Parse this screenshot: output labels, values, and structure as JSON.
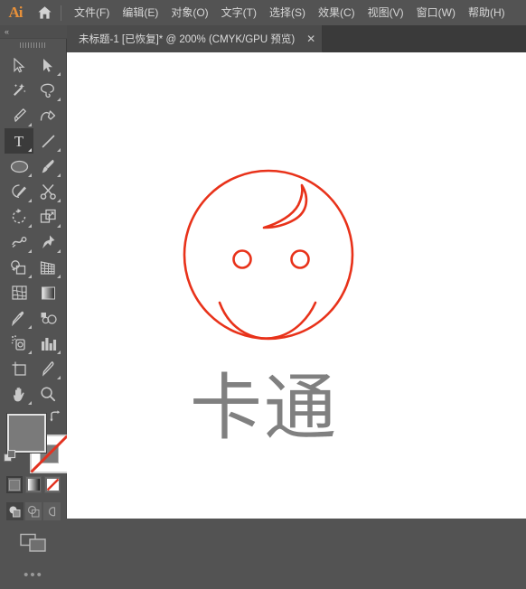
{
  "app": {
    "logo_text": "Ai",
    "home_icon": "home-icon"
  },
  "menubar": {
    "items": [
      {
        "label": "文件(F)",
        "name": "menu-file"
      },
      {
        "label": "编辑(E)",
        "name": "menu-edit"
      },
      {
        "label": "对象(O)",
        "name": "menu-object"
      },
      {
        "label": "文字(T)",
        "name": "menu-type"
      },
      {
        "label": "选择(S)",
        "name": "menu-select"
      },
      {
        "label": "效果(C)",
        "name": "menu-effect"
      },
      {
        "label": "视图(V)",
        "name": "menu-view"
      },
      {
        "label": "窗口(W)",
        "name": "menu-window"
      },
      {
        "label": "帮助(H)",
        "name": "menu-help"
      }
    ]
  },
  "tabbar": {
    "tab_title": "未标题-1 [已恢复]* @ 200% (CMYK/GPU 预览)",
    "close_label": "✕"
  },
  "toolbar": {
    "collapse_label": "«",
    "more_label": "•••",
    "tools": [
      {
        "name": "selection-tool",
        "icon": "arrow-outline-icon",
        "selected": false,
        "corner": false
      },
      {
        "name": "direct-selection-tool",
        "icon": "arrow-filled-icon",
        "selected": false,
        "corner": true
      },
      {
        "name": "magic-wand-tool",
        "icon": "magic-wand-icon",
        "selected": false,
        "corner": false
      },
      {
        "name": "lasso-tool",
        "icon": "lasso-icon",
        "selected": false,
        "corner": true
      },
      {
        "name": "pen-tool",
        "icon": "pen-icon",
        "selected": false,
        "corner": true
      },
      {
        "name": "curvature-tool",
        "icon": "curvature-icon",
        "selected": false,
        "corner": false
      },
      {
        "name": "type-tool",
        "icon": "type-icon",
        "selected": true,
        "corner": true
      },
      {
        "name": "line-segment-tool",
        "icon": "line-icon",
        "selected": false,
        "corner": true
      },
      {
        "name": "ellipse-tool",
        "icon": "ellipse-icon",
        "selected": false,
        "corner": true
      },
      {
        "name": "paintbrush-tool",
        "icon": "paintbrush-icon",
        "selected": false,
        "corner": true
      },
      {
        "name": "shaper-tool",
        "icon": "shaper-pencil-icon",
        "selected": false,
        "corner": true
      },
      {
        "name": "scissors-tool",
        "icon": "scissors-icon",
        "selected": false,
        "corner": true
      },
      {
        "name": "rotate-tool",
        "icon": "rotate-icon",
        "selected": false,
        "corner": true
      },
      {
        "name": "scale-tool",
        "icon": "scale-icon",
        "selected": false,
        "corner": true
      },
      {
        "name": "width-tool",
        "icon": "width-warp-icon",
        "selected": false,
        "corner": true
      },
      {
        "name": "free-transform-tool",
        "icon": "pushpin-icon",
        "selected": false,
        "corner": true
      },
      {
        "name": "shape-builder-tool",
        "icon": "shape-builder-icon",
        "selected": false,
        "corner": true
      },
      {
        "name": "perspective-grid-tool",
        "icon": "perspective-grid-icon",
        "selected": false,
        "corner": true
      },
      {
        "name": "mesh-tool",
        "icon": "mesh-icon",
        "selected": false,
        "corner": false
      },
      {
        "name": "gradient-tool",
        "icon": "gradient-icon",
        "selected": false,
        "corner": false
      },
      {
        "name": "eyedropper-tool",
        "icon": "eyedropper-icon",
        "selected": false,
        "corner": true
      },
      {
        "name": "blend-tool",
        "icon": "blend-icon",
        "selected": false,
        "corner": false
      },
      {
        "name": "symbol-sprayer-tool",
        "icon": "symbol-sprayer-icon",
        "selected": false,
        "corner": true
      },
      {
        "name": "column-graph-tool",
        "icon": "bar-chart-icon",
        "selected": false,
        "corner": true
      },
      {
        "name": "artboard-tool",
        "icon": "artboard-icon",
        "selected": false,
        "corner": false
      },
      {
        "name": "slice-tool",
        "icon": "slice-knife-icon",
        "selected": false,
        "corner": true
      },
      {
        "name": "hand-tool",
        "icon": "hand-icon",
        "selected": false,
        "corner": true
      },
      {
        "name": "zoom-tool",
        "icon": "magnifier-icon",
        "selected": false,
        "corner": false
      }
    ],
    "swatches": {
      "fill_color": "#7a7a7a",
      "stroke_color": "none",
      "fill_name": "fill-swatch",
      "stroke_name": "stroke-swatch",
      "swap_icon": "swap-fill-stroke-icon",
      "default_icon": "default-fill-stroke-icon"
    },
    "color_modes": [
      {
        "name": "color-mode-solid",
        "icon": "solid-color-icon",
        "active": true
      },
      {
        "name": "color-mode-gradient",
        "icon": "gradient-color-icon",
        "active": false
      },
      {
        "name": "color-mode-none",
        "icon": "none-color-icon",
        "active": false
      }
    ],
    "draw_modes": [
      {
        "name": "draw-normal-mode",
        "icon": "draw-normal-icon",
        "active": true
      },
      {
        "name": "draw-behind-mode",
        "icon": "draw-behind-icon",
        "active": false
      },
      {
        "name": "draw-inside-mode",
        "icon": "draw-inside-icon",
        "active": false
      }
    ],
    "screen_mode": {
      "name": "screen-mode-button",
      "icon": "screen-mode-icon"
    }
  },
  "canvas": {
    "artwork_name": "cartoon-baby-face-artwork",
    "artwork_stroke_color": "#e8321a",
    "caption_text": "卡通",
    "caption_color": "#808080",
    "background_color": "#ffffff"
  }
}
